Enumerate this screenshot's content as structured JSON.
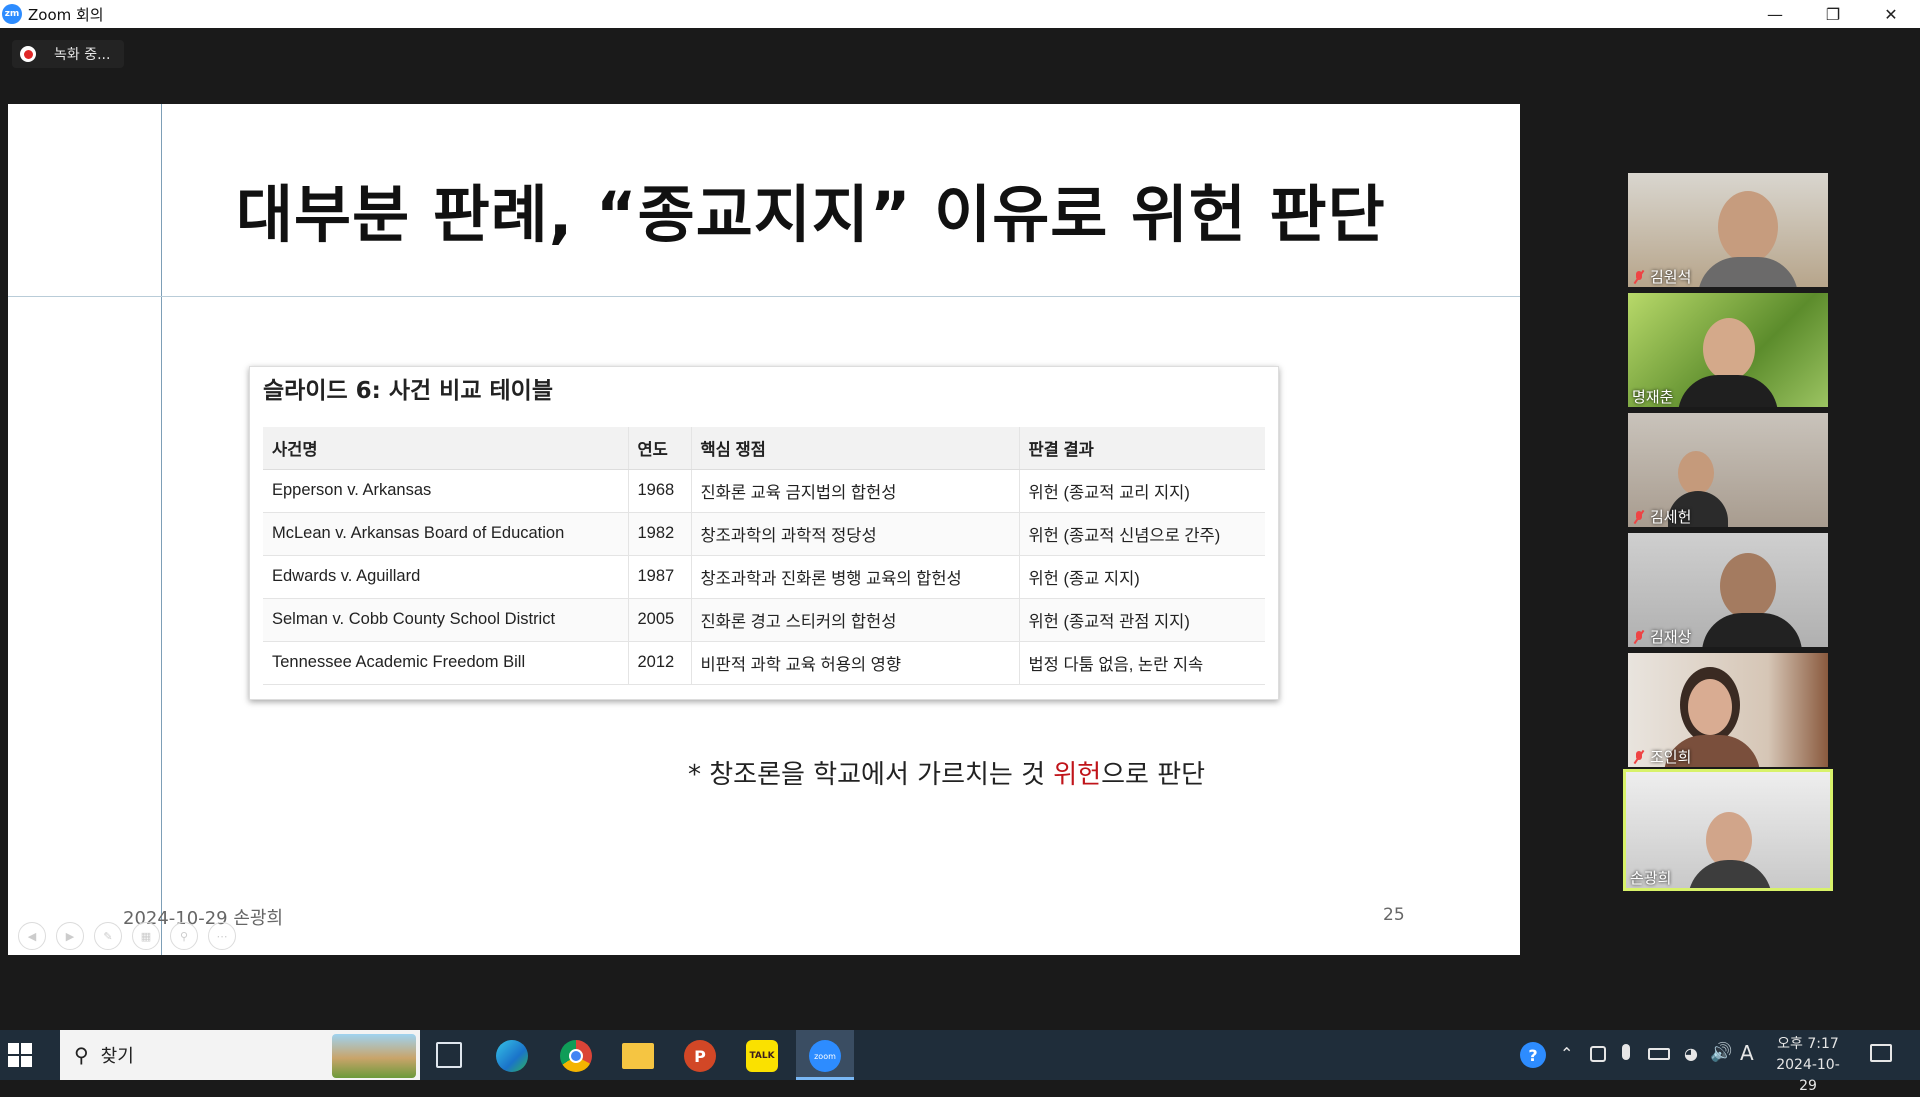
{
  "window": {
    "title": "Zoom 회의",
    "app_icon": "zm"
  },
  "recording": {
    "label": "녹화 중..."
  },
  "slide": {
    "title": "대부분 판례, “종교지지” 이유로 위헌 판단",
    "card_title": "슬라이드 6: 사건 비교 테이블",
    "table": {
      "headers": [
        "사건명",
        "연도",
        "핵심 쟁점",
        "판결 결과"
      ],
      "rows": [
        [
          "Epperson v. Arkansas",
          "1968",
          "진화론 교육 금지법의 합헌성",
          "위헌 (종교적 교리 지지)"
        ],
        [
          "McLean v. Arkansas Board of Education",
          "1982",
          "창조과학의 과학적 정당성",
          "위헌 (종교적 신념으로 간주)"
        ],
        [
          "Edwards v. Aguillard",
          "1987",
          "창조과학과 진화론 병행 교육의 합헌성",
          "위헌 (종교 지지)"
        ],
        [
          "Selman v. Cobb County School District",
          "2005",
          "진화론 경고 스티커의 합헌성",
          "위헌 (종교적 관점 지지)"
        ],
        [
          "Tennessee Academic Freedom Bill",
          "2012",
          "비판적 과학 교육 허용의 영향",
          "법정 다툼 없음, 논란 지속"
        ]
      ]
    },
    "note_prefix": "* 창조론을 학교에서 가르치는 것 ",
    "note_emphasis": "위헌",
    "note_suffix": "으로 판단",
    "footer": "2024-10-29 손광희",
    "page_number": "25"
  },
  "participants": [
    {
      "name": "김원석",
      "muted": true
    },
    {
      "name": "명재춘",
      "muted": false
    },
    {
      "name": "김세헌",
      "muted": true
    },
    {
      "name": "김재상",
      "muted": true
    },
    {
      "name": "조인희",
      "muted": true
    },
    {
      "name": "손광희",
      "muted": false,
      "active": true
    }
  ],
  "taskbar": {
    "search_label": "찾기",
    "clock_ampm_time": "오후 7:17",
    "clock_date": "2024-10-29",
    "ime": "A",
    "apps": [
      "task-view",
      "edge",
      "chrome",
      "file-explorer",
      "powerpoint",
      "kakaotalk",
      "zoom"
    ]
  },
  "colors": {
    "accent": "#2d8cff",
    "emphasis": "#c0141a",
    "active_speaker": "#d8f26a"
  }
}
